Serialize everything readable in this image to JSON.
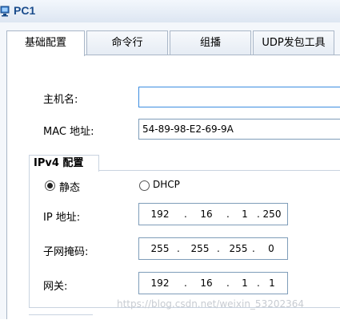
{
  "window": {
    "title": "PC1",
    "icon": "pc-icon"
  },
  "tabs": [
    {
      "label": "基础配置",
      "active": true
    },
    {
      "label": "命令行",
      "active": false
    },
    {
      "label": "组播",
      "active": false
    },
    {
      "label": "UDP发包工具",
      "active": false
    }
  ],
  "basic": {
    "hostname_label": "主机名:",
    "hostname_value": "",
    "mac_label": "MAC 地址:",
    "mac_value": "54-89-98-E2-69-9A"
  },
  "ipv4": {
    "group_title": "IPv4 配置",
    "mode_static_label": "静态",
    "mode_dhcp_label": "DHCP",
    "mode_selected": "静态",
    "ip_label": "IP 地址:",
    "ip_octets": [
      "192",
      "16",
      "1",
      "250"
    ],
    "mask_label": "子网掩码:",
    "mask_octets": [
      "255",
      "255",
      "255",
      "0"
    ],
    "gateway_label": "网关:",
    "gateway_octets": [
      "192",
      "16",
      "1",
      "1"
    ]
  },
  "watermark": "https://blog.csdn.net/weixin_53202364",
  "colors": {
    "title_text": "#1a4c8c",
    "focus_border": "#3c8de0",
    "field_border": "#7f9db9"
  }
}
